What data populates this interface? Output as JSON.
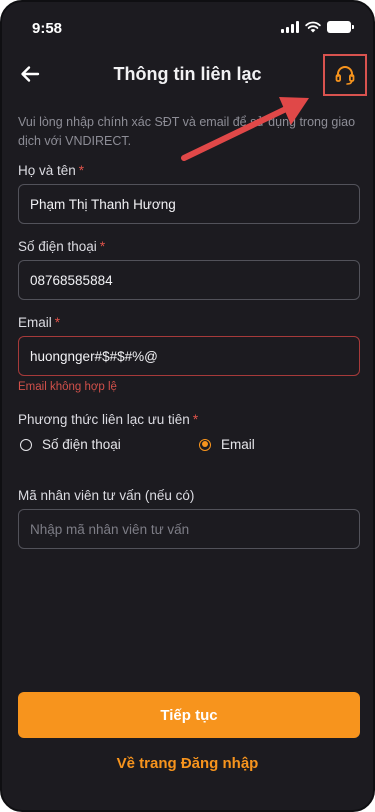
{
  "status_bar": {
    "time": "9:58"
  },
  "header": {
    "title": "Thông tin liên lạc"
  },
  "description": "Vui lòng nhập chính xác SĐT và email để sử dụng trong giao dịch với VNDIRECT.",
  "form": {
    "name": {
      "label": "Họ và tên",
      "required_mark": "*",
      "value": "Phạm Thị Thanh Hương"
    },
    "phone": {
      "label": "Số điện thoại",
      "required_mark": "*",
      "value": "08768585884"
    },
    "email": {
      "label": "Email",
      "required_mark": "*",
      "value": "huongnger#$#$#%@",
      "error": "Email không hợp lệ"
    },
    "contact_method": {
      "label": "Phương thức liên lạc ưu tiên",
      "required_mark": "*",
      "options": [
        "Số điện thoại",
        "Email"
      ],
      "selected": "Email"
    },
    "advisor": {
      "label": "Mã nhân viên tư vấn (nếu có)",
      "placeholder": "Nhập mã nhân viên tư vấn"
    }
  },
  "actions": {
    "continue_label": "Tiếp tục",
    "login_link_label": "Về trang Đăng nhập"
  },
  "colors": {
    "accent": "#f7941d",
    "background": "#1c1b20",
    "error": "#d0504a",
    "annotation": "#e04848"
  },
  "icons": {
    "back": "arrow-left-icon",
    "support": "headset-icon"
  }
}
